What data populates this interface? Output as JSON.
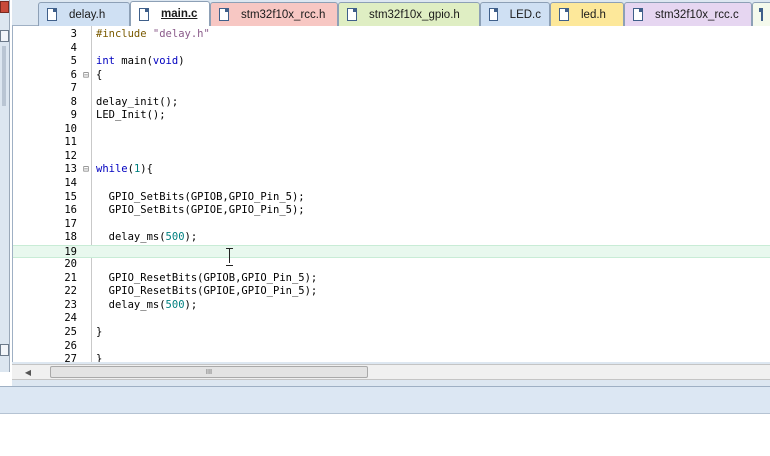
{
  "tabs": [
    {
      "label": "delay.h",
      "active": false
    },
    {
      "label": "main.c",
      "active": true
    },
    {
      "label": "stm32f10x_rcc.h",
      "active": false
    },
    {
      "label": "stm32f10x_gpio.h",
      "active": false
    },
    {
      "label": "LED.c",
      "active": false
    },
    {
      "label": "led.h",
      "active": false
    },
    {
      "label": "stm32f10x_rcc.c",
      "active": false
    },
    {
      "label": "",
      "active": false
    }
  ],
  "code": {
    "lines": [
      {
        "num": "3",
        "fold": "",
        "text": "#include \"delay.h\""
      },
      {
        "num": "4",
        "fold": "",
        "text": ""
      },
      {
        "num": "5",
        "fold": "",
        "text": "int main(void)"
      },
      {
        "num": "6",
        "fold": "⊟",
        "text": "{"
      },
      {
        "num": "7",
        "fold": "",
        "text": ""
      },
      {
        "num": "8",
        "fold": "",
        "text": "delay_init();"
      },
      {
        "num": "9",
        "fold": "",
        "text": "LED_Init();"
      },
      {
        "num": "10",
        "fold": "",
        "text": ""
      },
      {
        "num": "11",
        "fold": "",
        "text": ""
      },
      {
        "num": "12",
        "fold": "",
        "text": ""
      },
      {
        "num": "13",
        "fold": "⊟",
        "text": "while(1){"
      },
      {
        "num": "14",
        "fold": "",
        "text": ""
      },
      {
        "num": "15",
        "fold": "",
        "text": "  GPIO_SetBits(GPIOB,GPIO_Pin_5);"
      },
      {
        "num": "16",
        "fold": "",
        "text": "  GPIO_SetBits(GPIOE,GPIO_Pin_5);"
      },
      {
        "num": "17",
        "fold": "",
        "text": ""
      },
      {
        "num": "18",
        "fold": "",
        "text": "  delay_ms(500);"
      },
      {
        "num": "19",
        "fold": "",
        "text": ""
      },
      {
        "num": "20",
        "fold": "",
        "text": ""
      },
      {
        "num": "21",
        "fold": "",
        "text": "  GPIO_ResetBits(GPIOB,GPIO_Pin_5);"
      },
      {
        "num": "22",
        "fold": "",
        "text": "  GPIO_ResetBits(GPIOE,GPIO_Pin_5);"
      },
      {
        "num": "23",
        "fold": "",
        "text": "  delay_ms(500);"
      },
      {
        "num": "24",
        "fold": "",
        "text": ""
      },
      {
        "num": "25",
        "fold": "",
        "text": "}"
      },
      {
        "num": "26",
        "fold": "",
        "text": ""
      },
      {
        "num": "27",
        "fold": "",
        "text": "}"
      }
    ]
  },
  "scrollbar": {
    "grip": "III"
  },
  "colors": {
    "tab_bar_bg": "#dde7f1",
    "current_line_highlight": "#e8f8ee",
    "keyword": "#0000c0",
    "number": "#008080",
    "preprocessor": "#7a5a00",
    "string": "#8a5a8a"
  }
}
